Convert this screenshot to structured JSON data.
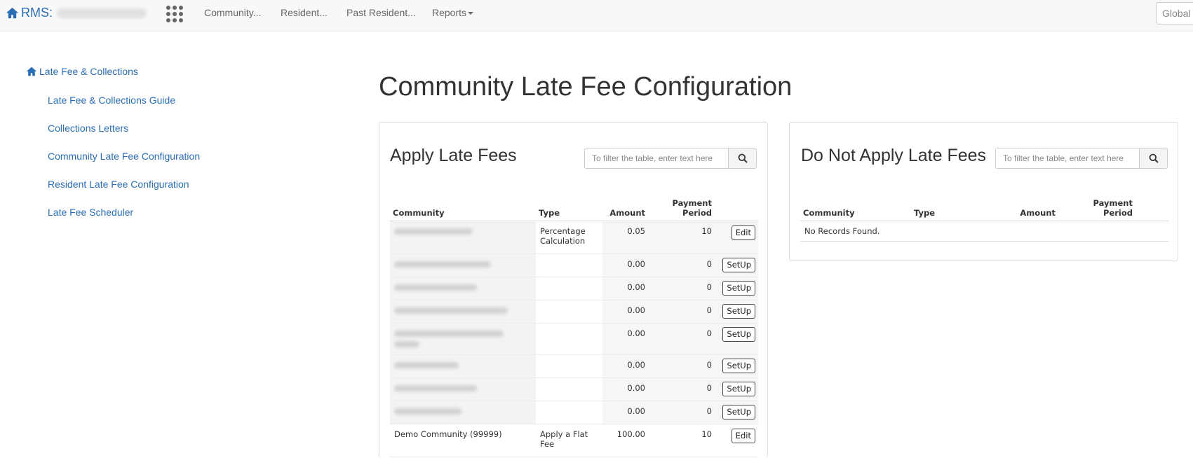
{
  "topnav": {
    "brand": "RMS:",
    "items": [
      "Community...",
      "Resident...",
      "Past Resident...",
      "Reports"
    ],
    "global_search_placeholder": "Global"
  },
  "sidebar": {
    "title": "Late Fee & Collections",
    "links": [
      "Late Fee & Collections Guide",
      "Collections Letters",
      "Community Late Fee Configuration",
      "Resident Late Fee Configuration",
      "Late Fee Scheduler"
    ]
  },
  "page_title": "Community Late Fee Configuration",
  "apply_panel": {
    "title": "Apply Late Fees",
    "search_placeholder": "To filter the table, enter text here",
    "columns": [
      "Community",
      "Type",
      "Amount",
      "Payment Period"
    ],
    "rows": [
      {
        "community": "",
        "type": "Percentage Calculation",
        "amount": "0.05",
        "period": "10",
        "action": "Edit"
      },
      {
        "community": "",
        "type": "",
        "amount": "0.00",
        "period": "0",
        "action": "SetUp"
      },
      {
        "community": "",
        "type": "",
        "amount": "0.00",
        "period": "0",
        "action": "SetUp"
      },
      {
        "community": "",
        "type": "",
        "amount": "0.00",
        "period": "0",
        "action": "SetUp"
      },
      {
        "community": "",
        "type": "",
        "amount": "0.00",
        "period": "0",
        "action": "SetUp"
      },
      {
        "community": "",
        "type": "",
        "amount": "0.00",
        "period": "0",
        "action": "SetUp"
      },
      {
        "community": "",
        "type": "",
        "amount": "0.00",
        "period": "0",
        "action": "SetUp"
      },
      {
        "community": "",
        "type": "",
        "amount": "0.00",
        "period": "0",
        "action": "SetUp"
      },
      {
        "community": "Demo Community (99999)",
        "type": "Apply a Flat Fee",
        "amount": "100.00",
        "period": "10",
        "action": "Edit"
      }
    ]
  },
  "donot_panel": {
    "title": "Do Not Apply Late Fees",
    "search_placeholder": "To filter the table, enter text here",
    "columns": [
      "Community",
      "Type",
      "Amount",
      "Payment Period"
    ],
    "empty_text": "No Records Found."
  }
}
